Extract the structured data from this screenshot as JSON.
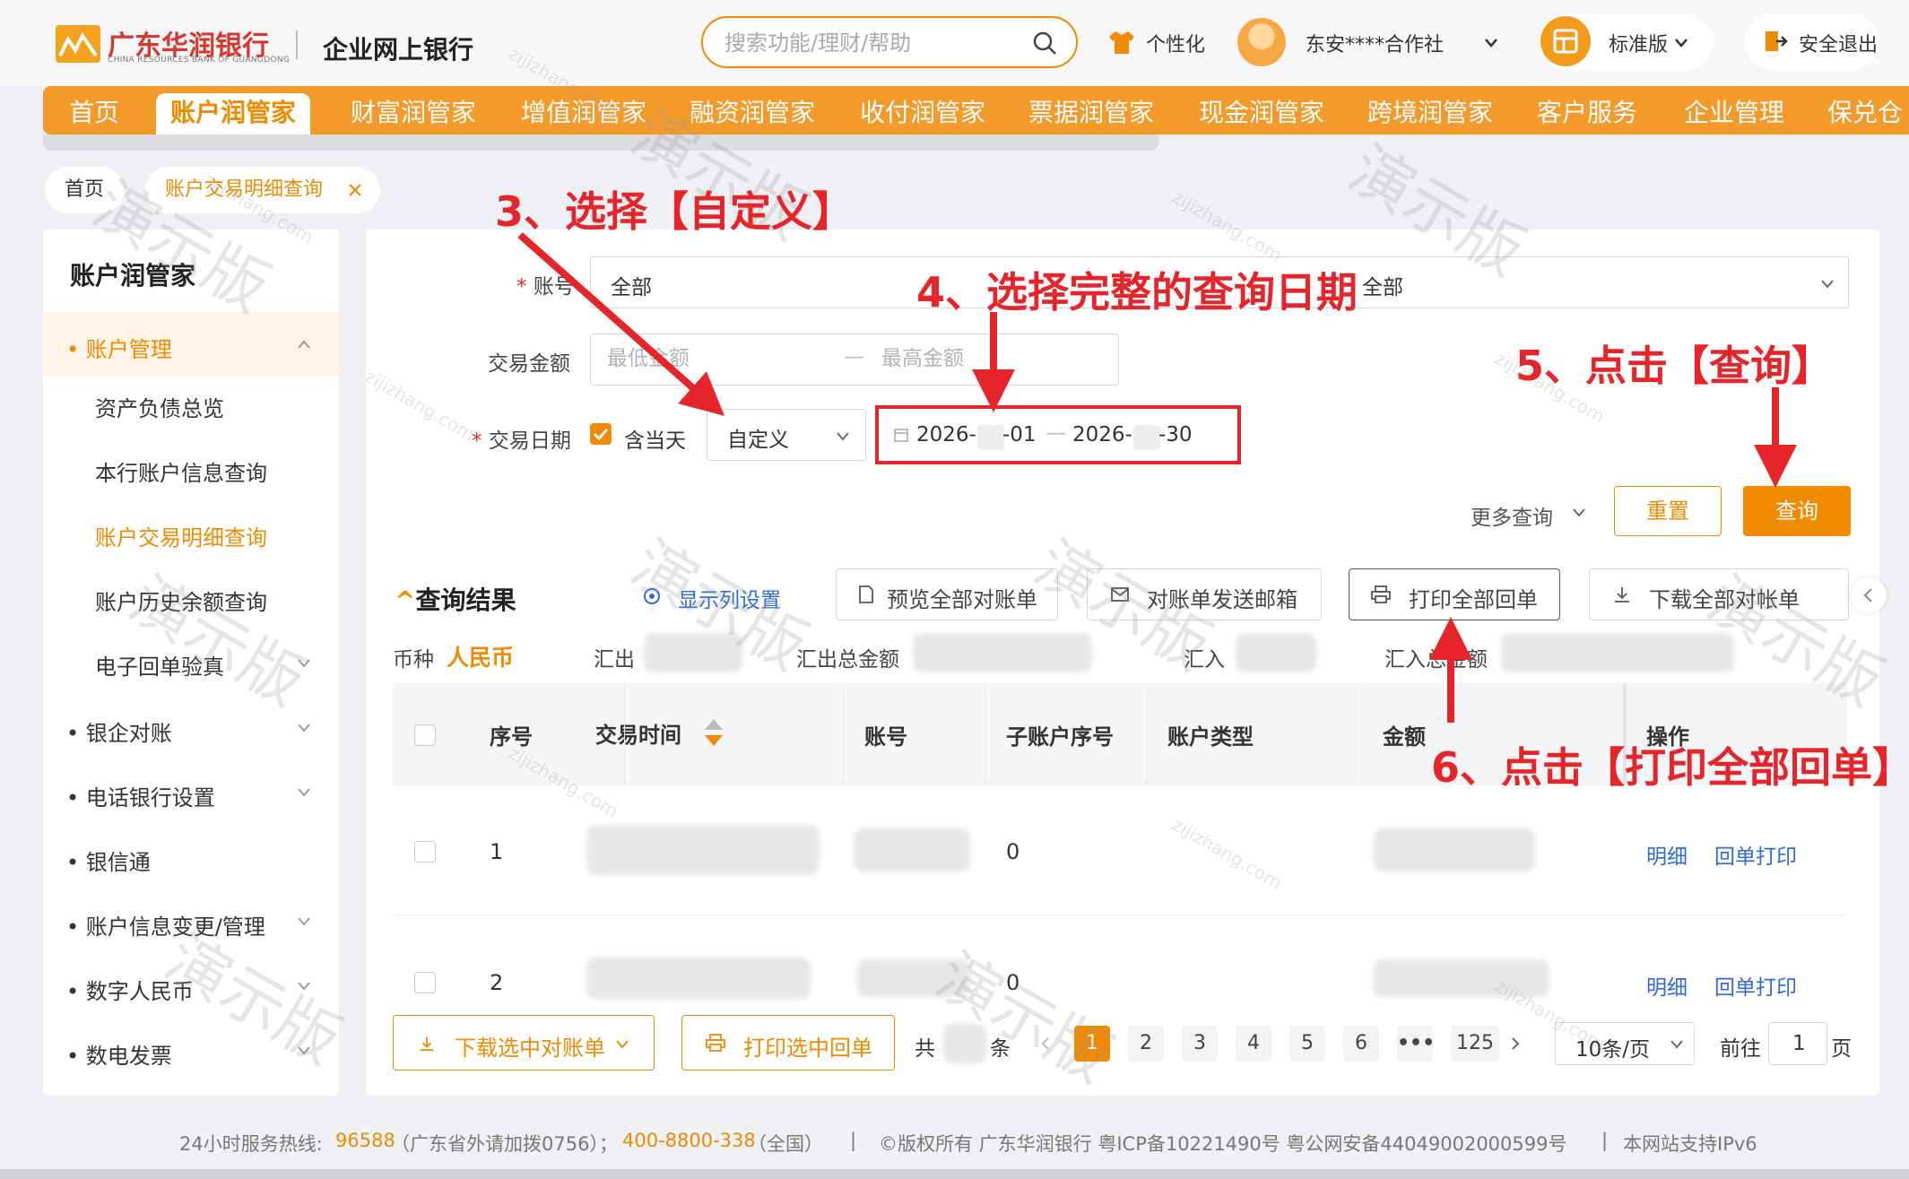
{
  "header": {
    "bank_name": "广东华润银行",
    "bank_name_en": "CHINA RESOURCES BANK OF GUANGDONG",
    "portal_name": "企业网上银行",
    "search_placeholder": "搜索功能/理财/帮助",
    "personalize": "个性化",
    "user_name": "东安****合作社",
    "version": "标准版",
    "logout": "安全退出"
  },
  "nav": {
    "items": [
      "首页",
      "账户润管家",
      "财富润管家",
      "增值润管家",
      "融资润管家",
      "收付润管家",
      "票据润管家",
      "现金润管家",
      "跨境润管家",
      "客户服务",
      "企业管理",
      "保兑仓"
    ],
    "active_index": 1
  },
  "breadcrumb": {
    "home": "首页",
    "current": "账户交易明细查询"
  },
  "sidebar": {
    "title": "账户润管家",
    "group_active": "账户管理",
    "sub_items": [
      "资产负债总览",
      "本行账户信息查询",
      "账户交易明细查询",
      "账户历史余额查询",
      "电子回单验真"
    ],
    "groups": [
      "银企对账",
      "电话银行设置",
      "银信通",
      "账户信息变更/管理",
      "数字人民币",
      "数电发票"
    ]
  },
  "form": {
    "account_label": "账号",
    "account_value": "全部",
    "account_type_value": "全部",
    "amount_label": "交易金额",
    "min_placeholder": "最低金额",
    "max_placeholder": "最高金额",
    "date_label": "交易日期",
    "include_today": "含当天",
    "date_mode": "自定义",
    "date_start": "2026-",
    "date_start_end": "-01",
    "date_end": "2026-",
    "date_end_end": "-30",
    "date_sep": "—",
    "more_query": "更多查询",
    "reset": "重置",
    "query": "查询"
  },
  "results": {
    "title": "查询结果",
    "column_settings": "显示列设置",
    "preview_all": "预览全部对账单",
    "email_statement": "对账单发送邮箱",
    "print_all": "打印全部回单",
    "download_all": "下载全部对帐单",
    "currency_label": "币种",
    "currency_value": "人民币",
    "out_label": "汇出",
    "out_total_label": "汇出总金额",
    "in_label": "汇入",
    "in_total_label": "汇入总金额"
  },
  "table": {
    "headers": [
      "序号",
      "交易时间",
      "账号",
      "子账户序号",
      "账户类型",
      "金额",
      "操作"
    ],
    "rows": [
      {
        "index": "1",
        "sub_account": "0",
        "action_detail": "明细",
        "action_print": "回单打印"
      },
      {
        "index": "2",
        "sub_account": "0",
        "action_detail": "明细",
        "action_print": "回单打印"
      }
    ]
  },
  "bottom": {
    "download_selected": "下载选中对账单",
    "print_selected": "打印选中回单",
    "total_prefix": "共",
    "total_suffix": "条",
    "pages": [
      "1",
      "2",
      "3",
      "4",
      "5",
      "6",
      "•••",
      "125"
    ],
    "page_size": "10条/页",
    "goto_prefix": "前往",
    "goto_value": "1",
    "goto_suffix": "页"
  },
  "footer": {
    "hotline_label": "24小时服务热线:",
    "hotline1": "96588",
    "hotline1_note": "（广东省外请加拨0756）；",
    "hotline2": "400-8800-338",
    "hotline2_note": "（全国）",
    "sep": "|",
    "copyright": "©版权所有  广东华润银行  粤ICP备10221490号  粤公网安备44049002000599号",
    "ipv6": "本网站支持IPv6"
  },
  "annotations": {
    "step3": "3、选择【自定义】",
    "step4": "4、选择完整的查询日期",
    "step5": "5、点击【查询】",
    "step6": "6、点击【打印全部回单】"
  },
  "watermark": {
    "text": "演示版",
    "site": "zijizhang.com"
  },
  "colors": {
    "accent": "#f08a00",
    "nav": "#f39a2a",
    "annotation": "#e5252a",
    "link": "#2f6ad9"
  }
}
